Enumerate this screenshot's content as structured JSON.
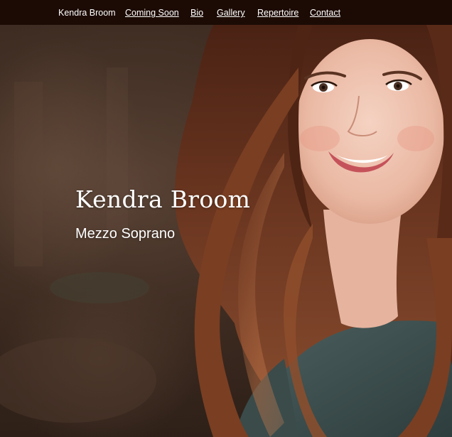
{
  "nav": {
    "brand": "Kendra Broom",
    "links": [
      "Coming Soon",
      "Bio",
      "Gallery",
      "Repertoire",
      "Contact"
    ]
  },
  "hero": {
    "title": "Kendra Broom",
    "subtitle": "Mezzo Soprano",
    "image": "portrait-photo"
  },
  "colors": {
    "nav_bg": "#1c0b05",
    "text": "#ffffff",
    "hair": "#5a2a18",
    "shirt": "#3c4f4e"
  }
}
